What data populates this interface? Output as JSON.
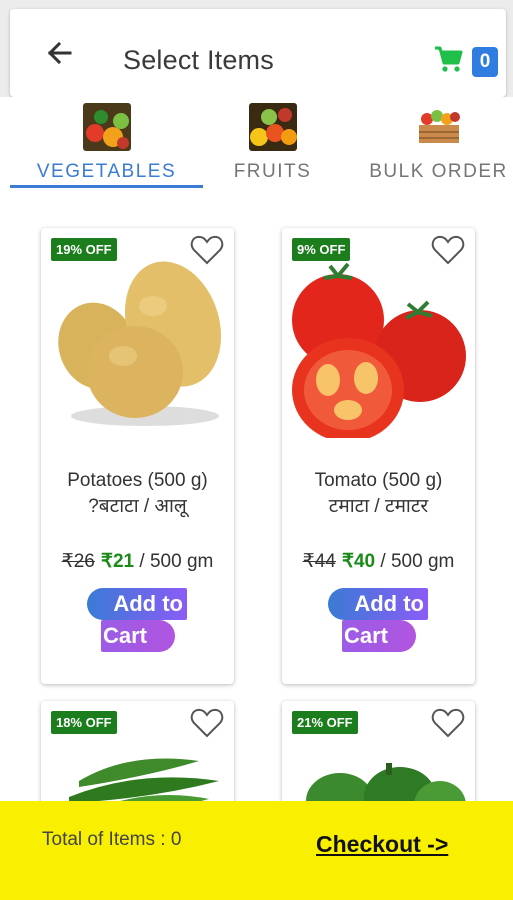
{
  "header": {
    "title": "Select Items",
    "cart_count": "0",
    "accent_color": "#2f7de1",
    "cart_icon_color": "#1fbf4a"
  },
  "tabs": [
    {
      "label": "VEGETABLES",
      "icon": "vegetables-thumb",
      "active": true
    },
    {
      "label": "FRUITS",
      "icon": "fruits-thumb",
      "active": false
    },
    {
      "label": "BULK ORDER",
      "icon": "bulk-crate-thumb",
      "active": false
    }
  ],
  "products": [
    {
      "discount": "19% OFF",
      "name": "Potatoes (500 g)",
      "local_name": "?बटाटा / आलू",
      "mrp": "₹26",
      "price": "₹21",
      "unit": "/ 500 gm",
      "button_line1": "Add to",
      "button_line2": "Cart",
      "image": "potato"
    },
    {
      "discount": "9% OFF",
      "name": "Tomato (500 g)",
      "local_name": "टमाटा / टमाटर",
      "mrp": "₹44",
      "price": "₹40",
      "unit": "/ 500 gm",
      "button_line1": "Add to",
      "button_line2": "Cart",
      "image": "tomato"
    },
    {
      "discount": "18% OFF",
      "image": "okra"
    },
    {
      "discount": "21% OFF",
      "image": "capsicum"
    }
  ],
  "footer": {
    "total_label": "Total of Items : 0",
    "checkout_label": "Checkout ->",
    "background": "#f8f000"
  },
  "colors": {
    "discount_badge": "#1b7d1b",
    "sale_price": "#1b8a1b",
    "tab_active": "#3a7bd5"
  }
}
